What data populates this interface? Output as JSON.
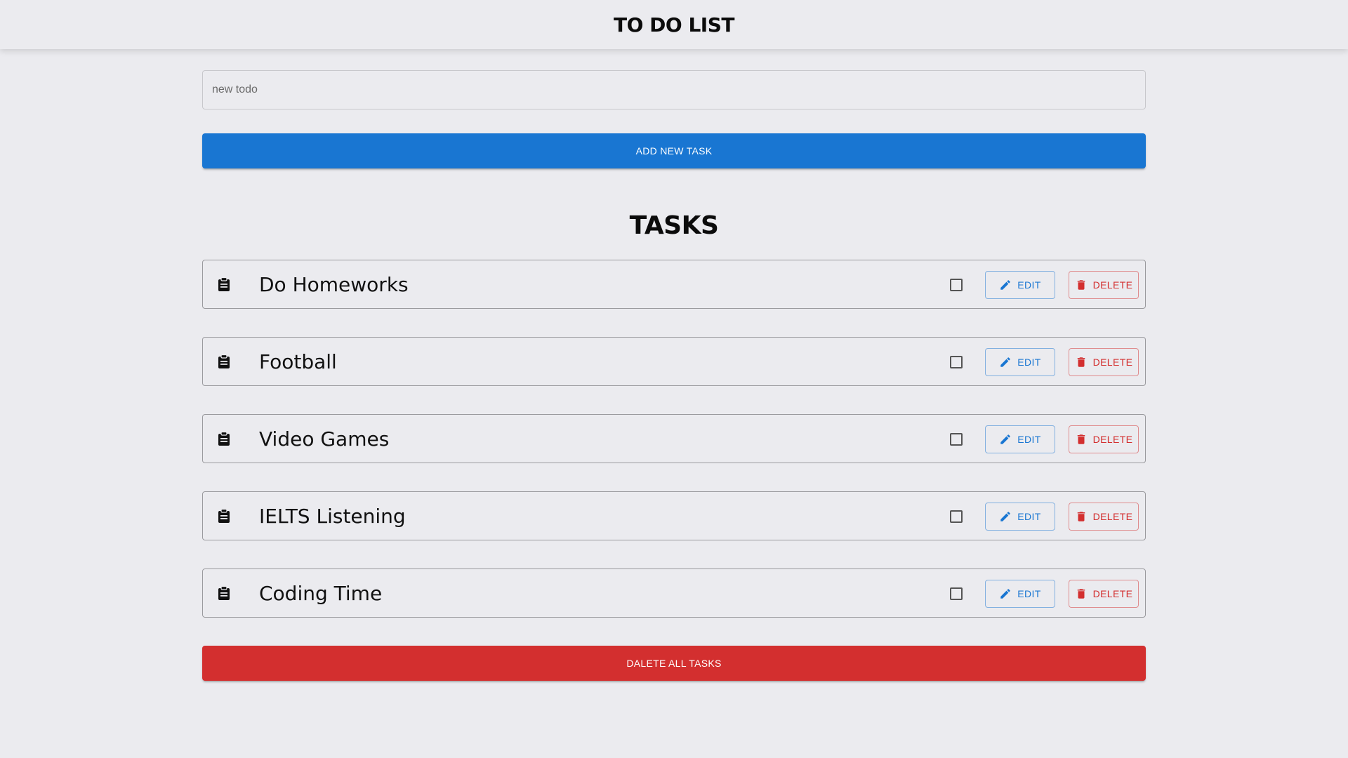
{
  "header": {
    "title": "TO DO LIST"
  },
  "new_todo": {
    "value": "",
    "placeholder": "new todo"
  },
  "add_button_label": "ADD NEW TASK",
  "tasks_title": "TASKS",
  "tasks": [
    {
      "text": "Do Homeworks",
      "completed": false,
      "icon": "clipboard-icon"
    },
    {
      "text": "Football",
      "completed": false,
      "icon": "clipboard-icon"
    },
    {
      "text": "Video Games",
      "completed": false,
      "icon": "clipboard-icon"
    },
    {
      "text": "IELTS Listening",
      "completed": false,
      "icon": "clipboard-icon"
    },
    {
      "text": "Coding Time",
      "completed": false,
      "icon": "clipboard-icon"
    }
  ],
  "task_actions": {
    "edit_label": "EDIT",
    "edit_icon": "pencil-icon",
    "delete_label": "DELETE",
    "delete_icon": "trash-icon"
  },
  "delete_all_label": "DALETE ALL TASKS",
  "colors": {
    "background": "#ebebef",
    "primary": "#1976d2",
    "danger": "#d32f2f",
    "text": "#111111"
  }
}
